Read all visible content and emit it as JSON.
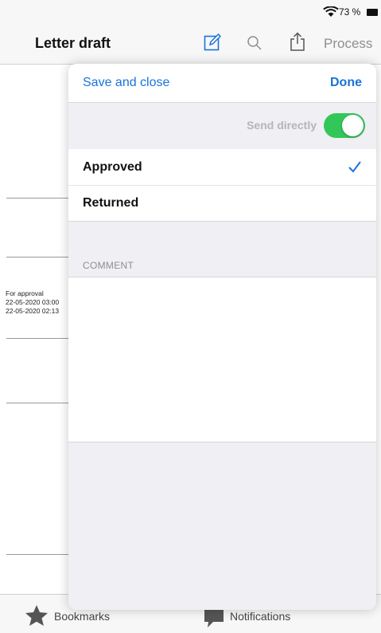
{
  "status_bar": {
    "battery_text": "73 %"
  },
  "nav": {
    "title": "Letter draft",
    "process_label": "Process"
  },
  "background": {
    "doc_lines": [
      "For approval",
      "22-05-2020 03:00",
      "22-05-2020 02:13"
    ]
  },
  "sheet": {
    "save_close_label": "Save and close",
    "done_label": "Done",
    "send_directly_label": "Send directly",
    "send_directly_on": true,
    "options": [
      {
        "label": "Approved",
        "selected": true
      },
      {
        "label": "Returned",
        "selected": false
      }
    ],
    "comment_header": "COMMENT",
    "comment_value": ""
  },
  "tab_bar": {
    "bookmarks_label": "Bookmarks",
    "notifications_label": "Notifications"
  },
  "colors": {
    "accent": "#1a73d9",
    "toggle_on": "#33c759",
    "notification_badge": "#e0332b"
  },
  "icons": [
    "wifi-icon",
    "battery-icon",
    "edit-icon",
    "search-icon",
    "share-icon",
    "checkmark-icon",
    "star-icon",
    "speech-bubble-icon"
  ]
}
